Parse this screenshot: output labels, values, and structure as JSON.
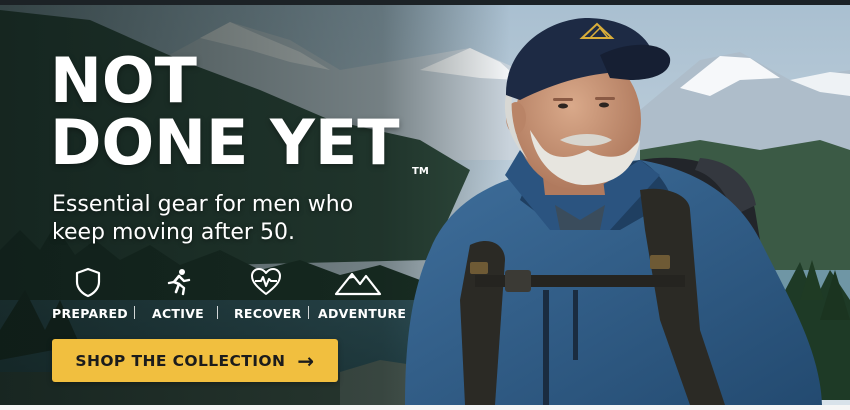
{
  "banner": {
    "headline_line1": "NOT",
    "headline_line2": "DONE YET",
    "trademark": "TM",
    "subheadline_line1": "Essential gear for men who",
    "subheadline_line2": "keep moving after 50.",
    "features": [
      {
        "label": "PREPARED",
        "icon": "shield-icon"
      },
      {
        "label": "ACTIVE",
        "icon": "running-person-icon"
      },
      {
        "label": "RECOVER",
        "icon": "heart-pulse-icon"
      },
      {
        "label": "ADVENTURE",
        "icon": "mountain-icon"
      }
    ],
    "cta_label": "SHOP THE COLLECTION",
    "cta_arrow": "→"
  },
  "colors": {
    "accent": "#f1bf3f",
    "text": "#ffffff",
    "jacket": "#2e5a86",
    "cap": "#1d2a44"
  }
}
